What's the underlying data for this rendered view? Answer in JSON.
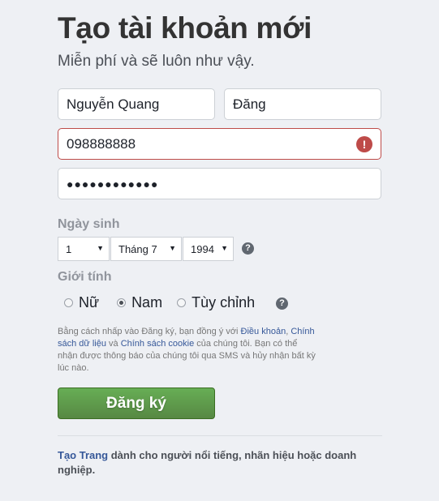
{
  "header": {
    "title": "Tạo tài khoản mới",
    "subtitle": "Miễn phí và sẽ luôn như vậy."
  },
  "form": {
    "first_name": "Nguyễn Quang",
    "last_name": "Đăng",
    "phone": "098888888",
    "password_mask": "●●●●●●●●●●●●",
    "birthday_label": "Ngày sinh",
    "day": "1",
    "month": "Tháng 7",
    "year": "1994",
    "gender_label": "Giới tính",
    "genders": [
      "Nữ",
      "Nam",
      "Tùy chỉnh"
    ],
    "selected_gender": "Nam"
  },
  "terms": {
    "part1": "Bằng cách nhấp vào Đăng ký, bạn đồng ý với ",
    "link1": "Điều khoản",
    "part2": ", ",
    "link2": "Chính sách dữ liệu",
    "part3": " và ",
    "link3": "Chính sách cookie",
    "part4": " của chúng tôi. Bạn có thể nhận được thông báo của chúng tôi qua SMS và hủy nhận bất kỳ lúc nào."
  },
  "signup_button": "Đăng ký",
  "create_page": {
    "link": "Tạo Trang",
    "text": " dành cho người nổi tiếng, nhãn hiệu hoặc doanh nghiệp."
  },
  "icons": {
    "error": "error-icon",
    "help": "question-icon"
  },
  "colors": {
    "signup_green": "#5b9a48",
    "error_red": "#be4b49",
    "link_blue": "#365899"
  }
}
